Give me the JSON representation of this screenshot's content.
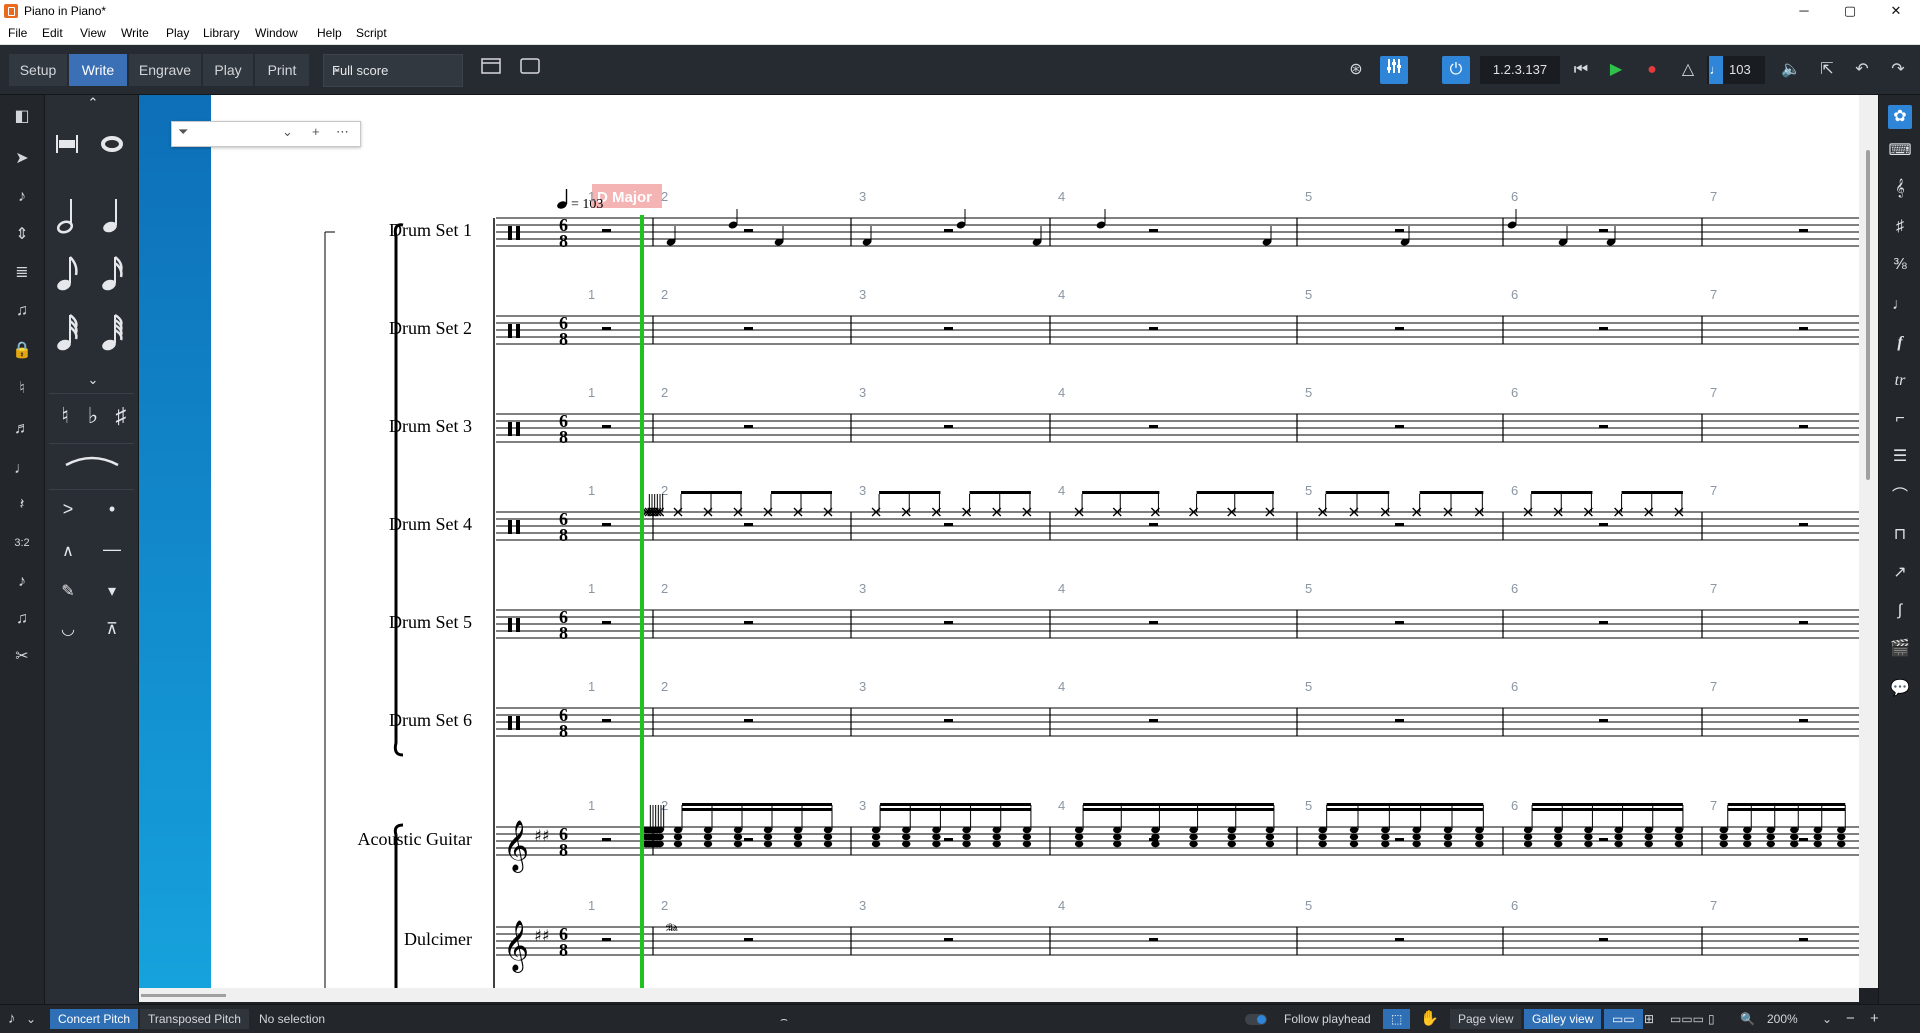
{
  "window": {
    "title": "Piano in Piano*",
    "controls": {
      "minimize": "─",
      "maximize": "▢",
      "close": "✕"
    }
  },
  "menu": [
    "File",
    "Edit",
    "View",
    "Write",
    "Play",
    "Library",
    "Window",
    "Help",
    "Script"
  ],
  "toolbar": {
    "modes": [
      "Setup",
      "Write",
      "Engrave",
      "Play",
      "Print"
    ],
    "active_mode": "Write",
    "layout_select": "Full score",
    "position": "1.2.3.137",
    "tempo_value": "103"
  },
  "score": {
    "key_signature": "D Major",
    "tempo_mark": "= 103",
    "instruments": [
      "Drum Set 1",
      "Drum Set 2",
      "Drum Set 3",
      "Drum Set 4",
      "Drum Set 5",
      "Drum Set 6",
      "Acoustic Guitar",
      "Dulcimer"
    ],
    "bar_numbers": [
      "1",
      "2",
      "3",
      "4",
      "5",
      "6",
      "7"
    ],
    "time_signature": {
      "top": "6",
      "bottom": "8"
    }
  },
  "statusbar": {
    "concert_pitch": "Concert Pitch",
    "transposed_pitch": "Transposed Pitch",
    "selection": "No selection",
    "follow_playhead": "Follow playhead",
    "page_view": "Page view",
    "galley_view": "Galley view",
    "zoom": "200%"
  },
  "colors": {
    "accent": "#2f86d9",
    "playhead": "#1fc21f",
    "key_signature_label": "#f3a7a7",
    "toolbar_bg": "#262b31"
  }
}
